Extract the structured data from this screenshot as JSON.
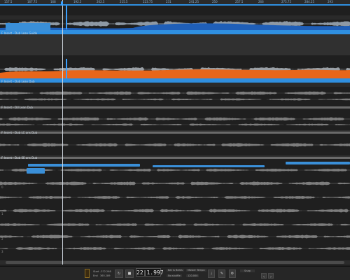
{
  "ruler": {
    "ticks": [
      "157.5",
      "167.75",
      "168",
      "192.5",
      "202.5",
      "215.5",
      "223.75",
      "231",
      "241.25",
      "250",
      "257.5",
      "266",
      "275.75",
      "284.25",
      "293"
    ]
  },
  "tracks": [
    {
      "label": "F Insert - Dub Lean Guide",
      "color": "#2f8fe0"
    },
    {
      "label": "F Insert - Dub Lean Dub",
      "color": "#e8661a"
    },
    {
      "label": "F Insert - D/I Lean Dub",
      "color": "#b0b0b0"
    },
    {
      "label": "F Insert - Dub LC ans Dub",
      "color": "#b0b0b0"
    },
    {
      "label": "F Insert - Dub SE ans Dub",
      "color": "#b0b0b0"
    }
  ],
  "markers": [
    "0",
    "1",
    "2",
    "3"
  ],
  "transport": {
    "timecode": "22|1.997",
    "start_label": "Start",
    "start_value": "-372.268",
    "end_label": "End",
    "end_value": "365.289",
    "rate_label": "Bar & Beats",
    "rate_value": "No shuffle",
    "tempo_label": "Master Tempo",
    "tempo_value": "120.000",
    "mode_value": "Snap"
  },
  "colors": {
    "accent": "#2f8fe0",
    "orange": "#e8661a",
    "bg": "#1f1f1f"
  }
}
